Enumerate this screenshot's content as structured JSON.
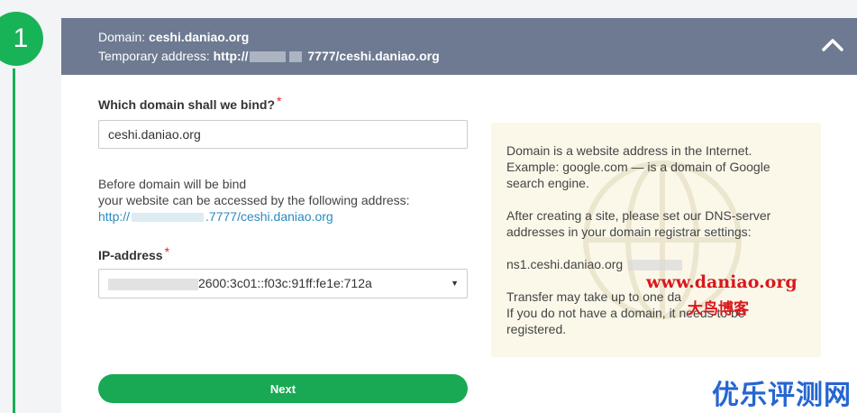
{
  "step": {
    "number": "1"
  },
  "header": {
    "domain_label": "Domain:",
    "domain_value": "ceshi.daniao.org",
    "temp_label": "Temporary address:",
    "temp_prefix": "http://",
    "temp_suffix": "7777/ceshi.daniao.org"
  },
  "form": {
    "domain_question": "Which domain shall we bind?",
    "required_mark": "*",
    "domain_value": "ceshi.daniao.org",
    "note_line1": "Before domain will be bind",
    "note_line2": "your website can be accessed by the following address:",
    "note_link_prefix": "http://",
    "note_link_suffix": ".7777/ceshi.daniao.org",
    "ip_label": "IP-address",
    "ip_value": "2600:3c01::f03c:91ff:fe1e:712a",
    "next_label": "Next"
  },
  "info": {
    "p1_line1": "Domain is a website address in the Internet.",
    "p1_line2": "Example: google.com — is a domain of Google",
    "p1_line3": "search engine.",
    "p2_line1": "After creating a site, please set our DNS-server",
    "p2_line2": "addresses in your domain registrar settings:",
    "ns1": "ns1.ceshi.daniao.org",
    "p4_line1": "Transfer may take up to one da",
    "p4_line2": "If you do not have a domain, it needs to be",
    "p4_line3": "registered."
  },
  "watermarks": {
    "site": "www.daniao.org",
    "cn": "大鸟博客",
    "corner": "优乐评测网"
  },
  "colors": {
    "accent": "#19a954",
    "header_bg": "#6d7a91",
    "info_bg": "#fbf8ea",
    "required": "#e0242a",
    "link": "#2a8bc0"
  }
}
